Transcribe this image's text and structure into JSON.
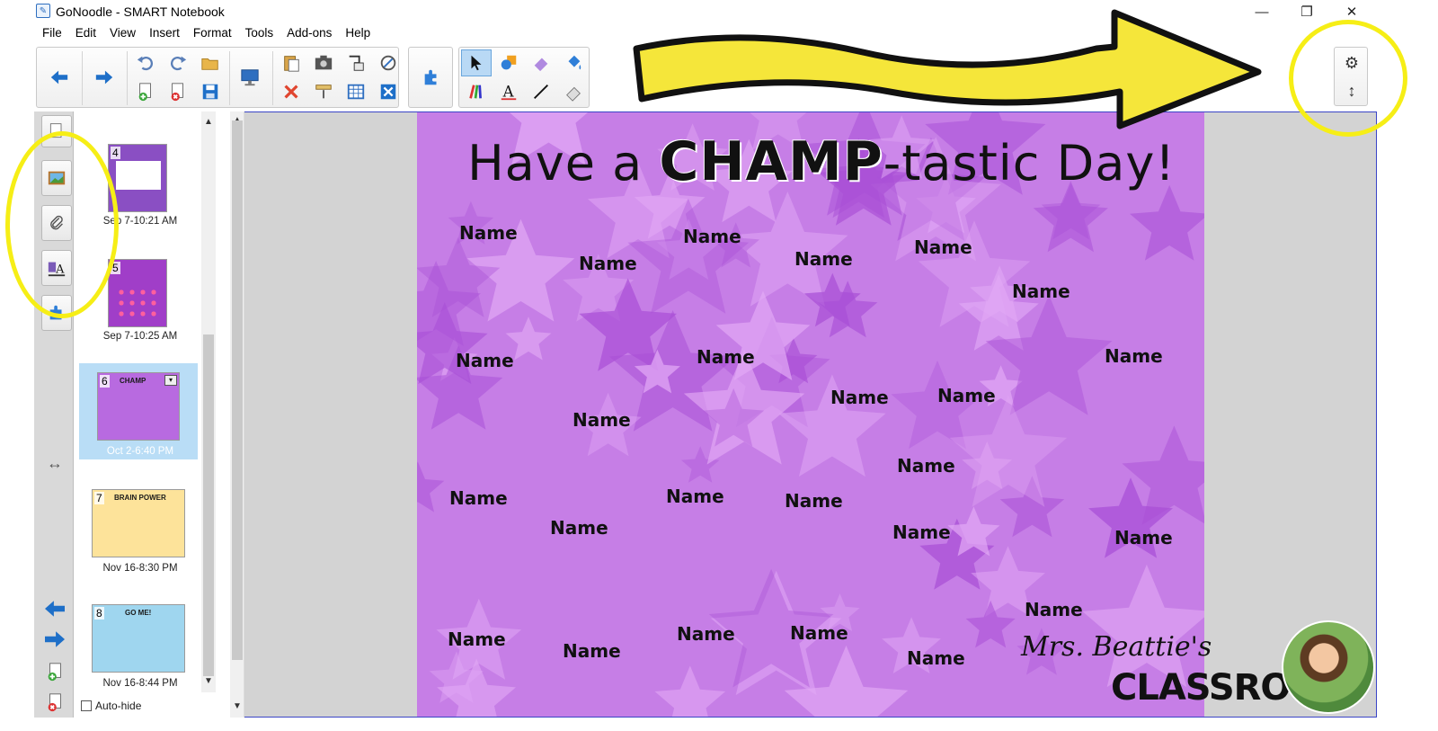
{
  "window": {
    "title": "GoNoodle - SMART Notebook",
    "minimize": "—",
    "restore": "❐",
    "close": "✕"
  },
  "menu": [
    "File",
    "Edit",
    "View",
    "Insert",
    "Format",
    "Tools",
    "Add-ons",
    "Help"
  ],
  "toolbar_icons": [
    "back-arrow-icon",
    "forward-arrow-icon",
    "undo-icon",
    "redo-icon",
    "open-folder-icon",
    "add-page-icon",
    "delete-page-icon",
    "save-icon",
    "display-icon",
    "paste-icon",
    "screen-capture-icon",
    "screen-shade-icon",
    "fullscreen-icon",
    "delete-icon",
    "table-icon",
    "properties-icon",
    "addon-icon",
    "select-icon",
    "shapes-icon",
    "eraser-icon",
    "fill-icon",
    "pens-icon",
    "text-icon",
    "line-icon",
    "magic-eraser-icon",
    "gear-icon",
    "resize-icon"
  ],
  "sorter": {
    "pages": [
      {
        "number": "4",
        "label": "Sep 7-10:21 AM",
        "color": "#8a4fc3"
      },
      {
        "number": "5",
        "label": "Sep 7-10:25 AM",
        "color": "#a03ec8"
      },
      {
        "number": "6",
        "label": "Oct 2-6:40 PM",
        "color": "#b86ae0",
        "title": "CHAMP"
      },
      {
        "number": "7",
        "label": "Nov 16-8:30 PM",
        "color": "#fde39a",
        "title": "BRAIN POWER"
      },
      {
        "number": "8",
        "label": "Nov 16-8:44 PM",
        "color": "#9fd6ef",
        "title": "GO ME!"
      }
    ],
    "autohide": "Auto-hide"
  },
  "page": {
    "title_pre": "Have a ",
    "title_bold": "CHAMP",
    "title_post": "-tastic Day!",
    "name_label": "Name",
    "brand_script": "Mrs. Beattie's",
    "brand_block": "CLASSROOM"
  },
  "colors": {
    "page_bg": "#c67ee6",
    "star_dark": "#a94fd6",
    "star_light": "#e2a9f5",
    "highlight": "#f6ee16",
    "selected_thumb": "#b9ddf6"
  }
}
